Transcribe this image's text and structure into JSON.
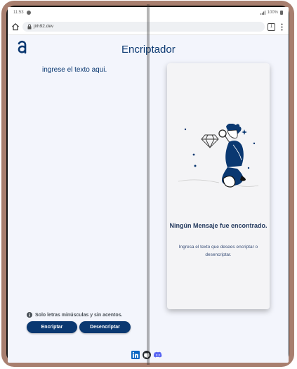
{
  "status": {
    "time": "11:53",
    "battery": "100%"
  },
  "browser": {
    "url": "jirh92.dev",
    "tab_count": "1"
  },
  "header": {
    "title": "Encriptador"
  },
  "input": {
    "placeholder": "ingrese el texto aqui."
  },
  "result": {
    "title": "Ningún Mensaje fue encontrado.",
    "text": "Ingresa el texto que desees encriptar o desencriptar."
  },
  "notice": {
    "text": "Solo letras minúsculas y sin acentos."
  },
  "buttons": {
    "encrypt": "Encriptar",
    "decrypt": "Desencriptar"
  },
  "footer": {
    "icons": [
      "linkedin-icon",
      "github-icon",
      "discord-icon"
    ]
  },
  "colors": {
    "primary": "#0a3871",
    "background": "#f3f5fc",
    "card": "#f4f4f6"
  }
}
